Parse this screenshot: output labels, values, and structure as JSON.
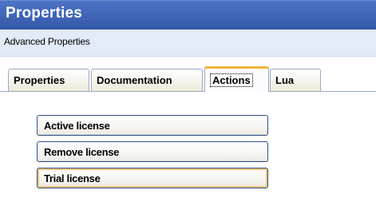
{
  "window": {
    "title": "Properties",
    "subtitle": "Advanced Properties"
  },
  "tabs": [
    {
      "label": "Properties",
      "active": false
    },
    {
      "label": "Documentation",
      "active": false
    },
    {
      "label": "Actions",
      "active": true
    },
    {
      "label": "Lua",
      "active": false
    }
  ],
  "actions": [
    {
      "label": "Active license"
    },
    {
      "label": "Remove license"
    },
    {
      "label": "Trial license",
      "focused": true
    }
  ],
  "colors": {
    "title_bar": "#3f66b8",
    "sub_bar": "#e3ebf8",
    "active_tab_accent": "#f5b13a",
    "button_border": "#2e4f8c"
  }
}
